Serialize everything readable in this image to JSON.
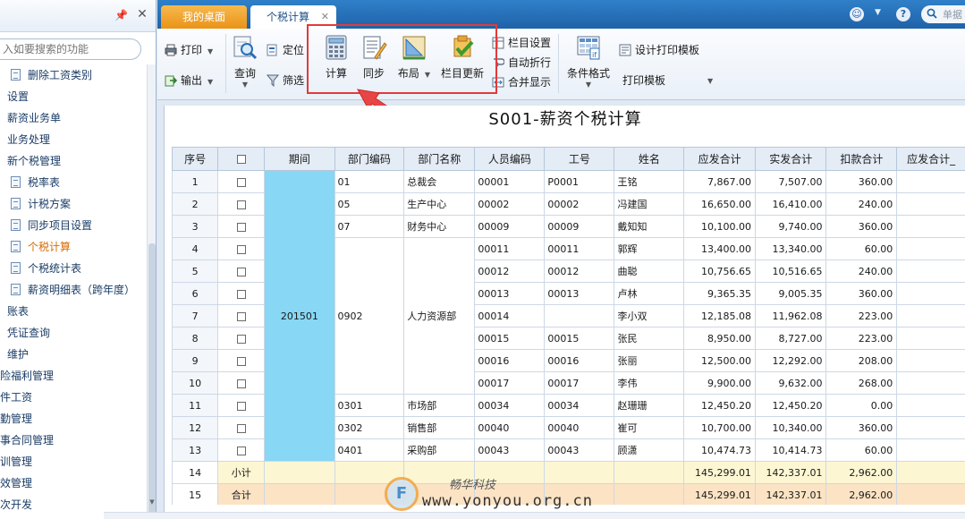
{
  "left_panel": {
    "search_placeholder": "入如要搜索的功能",
    "items": [
      {
        "label": "删除工资类别",
        "indent": 12,
        "icon": true
      },
      {
        "label": "设置",
        "indent": 8,
        "icon": false
      },
      {
        "label": "薪资业务单",
        "indent": 8,
        "icon": false
      },
      {
        "label": "业务处理",
        "indent": 8,
        "icon": false
      },
      {
        "label": "新个税管理",
        "indent": 8,
        "icon": false
      },
      {
        "label": "税率表",
        "indent": 12,
        "icon": true
      },
      {
        "label": "计税方案",
        "indent": 12,
        "icon": true
      },
      {
        "label": "同步项目设置",
        "indent": 12,
        "icon": true
      },
      {
        "label": "个税计算",
        "indent": 12,
        "icon": true,
        "active": true
      },
      {
        "label": "个税统计表",
        "indent": 12,
        "icon": true
      },
      {
        "label": "薪资明细表（跨年度）",
        "indent": 12,
        "icon": true
      },
      {
        "label": "账表",
        "indent": 8,
        "icon": false
      },
      {
        "label": "凭证查询",
        "indent": 8,
        "icon": false
      },
      {
        "label": "维护",
        "indent": 8,
        "icon": false
      },
      {
        "label": "险福利管理",
        "indent": 0,
        "icon": false
      },
      {
        "label": "件工资",
        "indent": 0,
        "icon": false
      },
      {
        "label": "勤管理",
        "indent": 0,
        "icon": false
      },
      {
        "label": "事合同管理",
        "indent": 0,
        "icon": false
      },
      {
        "label": "训管理",
        "indent": 0,
        "icon": false
      },
      {
        "label": "效管理",
        "indent": 0,
        "icon": false
      },
      {
        "label": "次开发",
        "indent": 0,
        "icon": false
      }
    ]
  },
  "tabs": {
    "desktop": "我的桌面",
    "tax": "个税计算"
  },
  "top_search": {
    "text": "单据"
  },
  "toolbar": {
    "print": "打印",
    "export": "输出",
    "query": "查询",
    "locate": "定位",
    "filter": "筛选",
    "calculate": "计算",
    "sync": "同步",
    "layout": "布局",
    "update_columns": "栏目更新",
    "column_settings": "栏目设置",
    "auto_wrap": "自动折行",
    "merge_display": "合并显示",
    "conditional_format": "条件格式",
    "design_print_template": "设计打印模板",
    "print_template": "打印模板"
  },
  "report": {
    "title": "S001-薪资个税计算",
    "headers": [
      "序号",
      "",
      "期间",
      "部门编码",
      "部门名称",
      "人员编码",
      "工号",
      "姓名",
      "应发合计",
      "实发合计",
      "扣款合计",
      "应发合计_"
    ],
    "period": "201501",
    "rows": [
      {
        "seq": "1",
        "dept_code": "01",
        "dept_name": "总裁会",
        "emp_code": "00001",
        "job_no": "P0001",
        "name": "王铭",
        "gross": "7,867.00",
        "net": "7,507.00",
        "deduction": "360.00"
      },
      {
        "seq": "2",
        "dept_code": "05",
        "dept_name": "生产中心",
        "emp_code": "00002",
        "job_no": "00002",
        "name": "冯建国",
        "gross": "16,650.00",
        "net": "16,410.00",
        "deduction": "240.00"
      },
      {
        "seq": "3",
        "dept_code": "07",
        "dept_name": "财务中心",
        "emp_code": "00009",
        "job_no": "00009",
        "name": "戴知知",
        "gross": "10,100.00",
        "net": "9,740.00",
        "deduction": "360.00"
      },
      {
        "seq": "4",
        "dept_code": "",
        "dept_name": "",
        "emp_code": "00011",
        "job_no": "00011",
        "name": "郭辉",
        "gross": "13,400.00",
        "net": "13,340.00",
        "deduction": "60.00"
      },
      {
        "seq": "5",
        "dept_code": "",
        "dept_name": "",
        "emp_code": "00012",
        "job_no": "00012",
        "name": "曲聪",
        "gross": "10,756.65",
        "net": "10,516.65",
        "deduction": "240.00"
      },
      {
        "seq": "6",
        "dept_code": "",
        "dept_name": "",
        "emp_code": "00013",
        "job_no": "00013",
        "name": "卢林",
        "gross": "9,365.35",
        "net": "9,005.35",
        "deduction": "360.00"
      },
      {
        "seq": "7",
        "dept_code": "0902",
        "dept_name": "人力资源部",
        "emp_code": "00014",
        "job_no": "",
        "name": "李小双",
        "gross": "12,185.08",
        "net": "11,962.08",
        "deduction": "223.00"
      },
      {
        "seq": "8",
        "dept_code": "",
        "dept_name": "",
        "emp_code": "00015",
        "job_no": "00015",
        "name": "张民",
        "gross": "8,950.00",
        "net": "8,727.00",
        "deduction": "223.00"
      },
      {
        "seq": "9",
        "dept_code": "",
        "dept_name": "",
        "emp_code": "00016",
        "job_no": "00016",
        "name": "张丽",
        "gross": "12,500.00",
        "net": "12,292.00",
        "deduction": "208.00"
      },
      {
        "seq": "10",
        "dept_code": "",
        "dept_name": "",
        "emp_code": "00017",
        "job_no": "00017",
        "name": "李伟",
        "gross": "9,900.00",
        "net": "9,632.00",
        "deduction": "268.00"
      },
      {
        "seq": "11",
        "dept_code": "0301",
        "dept_name": "市场部",
        "emp_code": "00034",
        "job_no": "00034",
        "name": "赵珊珊",
        "gross": "12,450.20",
        "net": "12,450.20",
        "deduction": "0.00"
      },
      {
        "seq": "12",
        "dept_code": "0302",
        "dept_name": "销售部",
        "emp_code": "00040",
        "job_no": "00040",
        "name": "崔可",
        "gross": "10,700.00",
        "net": "10,340.00",
        "deduction": "360.00"
      },
      {
        "seq": "13",
        "dept_code": "0401",
        "dept_name": "采购部",
        "emp_code": "00043",
        "job_no": "00043",
        "name": "顾潇",
        "gross": "10,474.73",
        "net": "10,414.73",
        "deduction": "60.00"
      }
    ],
    "subtotal": {
      "seq": "14",
      "label": "小计",
      "gross": "145,299.01",
      "net": "142,337.01",
      "deduction": "2,962.00"
    },
    "total": {
      "seq": "15",
      "label": "合计",
      "gross": "145,299.01",
      "net": "142,337.01",
      "deduction": "2,962.00"
    }
  },
  "watermark": {
    "logo_letter": "F",
    "brand": "畅华科技",
    "url": "www.yonyou.org.cn"
  },
  "colors": {
    "accent_blue": "#1f62a8",
    "desktop_tab": "#ea9317",
    "highlight_red": "#e23a3a",
    "period_cell": "#87d7f5",
    "subtotal_row": "#fdf6d3",
    "total_row": "#fbe3c4"
  }
}
